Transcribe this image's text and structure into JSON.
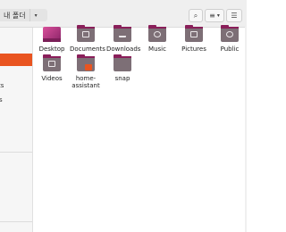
{
  "toolbar": {
    "location_label": "내 폴더",
    "location_caret": "▾",
    "search_glyph": "⌕",
    "view_glyph": "≡",
    "view_caret": "▾",
    "menu_glyph": "☰"
  },
  "sidebar": {
    "items": [
      {
        "label": "",
        "active": true
      },
      {
        "label": "ts",
        "active": false
      },
      {
        "label": "s",
        "active": false
      }
    ]
  },
  "files": [
    {
      "label": "Desktop",
      "icon": "desktop-folder-icon"
    },
    {
      "label": "Documents",
      "icon": "documents-folder-icon"
    },
    {
      "label": "Downloads",
      "icon": "downloads-folder-icon"
    },
    {
      "label": "Music",
      "icon": "music-folder-icon"
    },
    {
      "label": "Pictures",
      "icon": "pictures-folder-icon"
    },
    {
      "label": "Public",
      "icon": "public-folder-icon"
    },
    {
      "label": "Videos",
      "icon": "videos-folder-icon"
    },
    {
      "label": "home-\nassistant",
      "icon": "locked-folder-icon"
    },
    {
      "label": "snap",
      "icon": "folder-icon"
    }
  ],
  "colors": {
    "accent": "#e95420",
    "folder": "#7d6f76",
    "folder_tab": "#8a1f5a"
  }
}
